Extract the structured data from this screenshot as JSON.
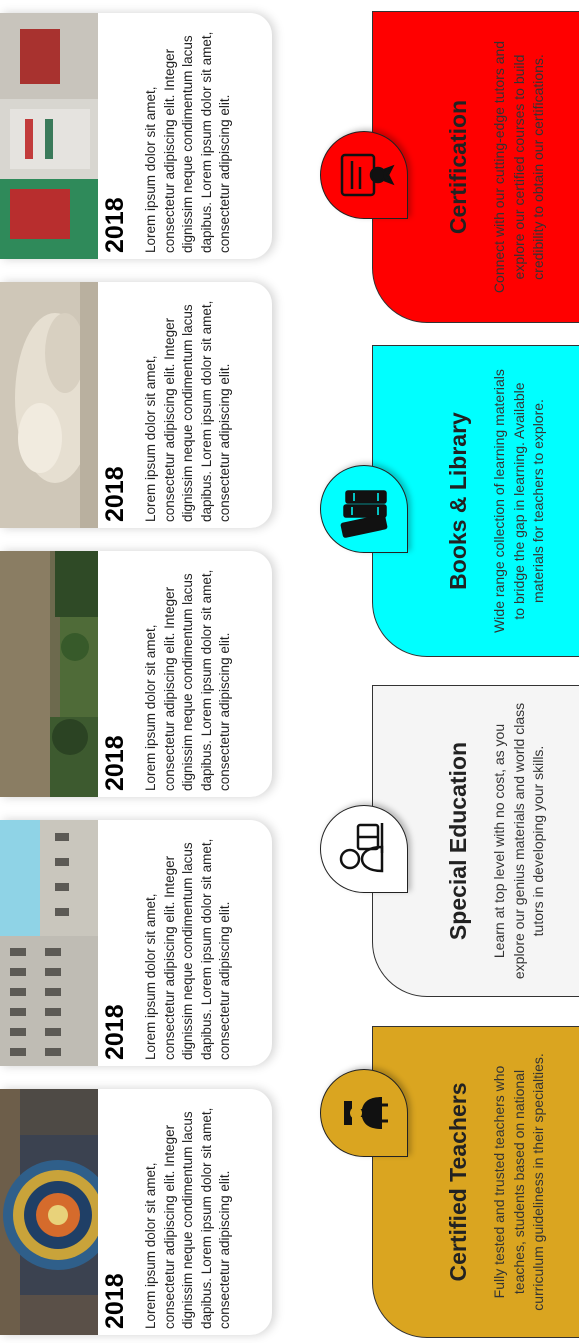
{
  "news": [
    {
      "year": "2018",
      "text": "Lorem ipsum dolor sit amet, consectetur adipiscing elit. Integer dignissim neque condimentum lacus dapibus. Lorem ipsum dolor sit amet, consectetur adipiscing elit."
    },
    {
      "year": "2018",
      "text": "Lorem ipsum dolor sit amet, consectetur adipiscing elit. Integer dignissim neque condimentum lacus dapibus. Lorem ipsum dolor sit amet, consectetur adipiscing elit."
    },
    {
      "year": "2018",
      "text": "Lorem ipsum dolor sit amet, consectetur adipiscing elit. Integer dignissim neque condimentum lacus dapibus. Lorem ipsum dolor sit amet, consectetur adipiscing elit."
    },
    {
      "year": "2018",
      "text": "Lorem ipsum dolor sit amet, consectetur adipiscing elit. Integer dignissim neque condimentum lacus dapibus. Lorem ipsum dolor sit amet, consectetur adipiscing elit."
    },
    {
      "year": "2018",
      "text": "Lorem ipsum dolor sit amet, consectetur adipiscing elit. Integer dignissim neque condimentum lacus dapibus. Lorem ipsum dolor sit amet, consectetur adipiscing elit."
    }
  ],
  "services": [
    {
      "title": "Certified Teachers",
      "text": "Fully tested and trusted teachers who teaches, students based on national curriculum guideliness in their specialties.",
      "color": "#daa520",
      "icon": "teacher-icon"
    },
    {
      "title": "Special Education",
      "text": "Learn at top level with no cost, as you explore our genius materials and world class tutors in developing your skills.",
      "color": "#f5f5f5",
      "icon": "student-reading-icon"
    },
    {
      "title": "Books & Library",
      "text": "Wide range collection of learning materials to bridge the gap in learning. Available materials for teachers to explore.",
      "color": "#00ffff",
      "icon": "books-icon"
    },
    {
      "title": "Certification",
      "text": "Connect with our cutting-edge tutors and explore our certified courses to build credibility to obtain our certifications.",
      "color": "#ff0000",
      "icon": "certificate-icon"
    }
  ]
}
